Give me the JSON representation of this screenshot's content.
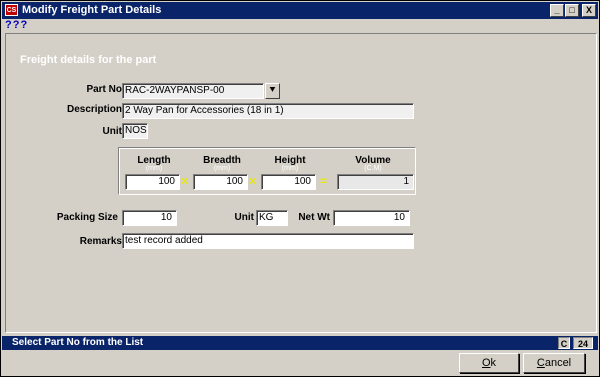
{
  "window": {
    "app_icon_text": "CS",
    "title": "Modify Freight Part Details",
    "btn_min": "_",
    "btn_max": "□",
    "btn_close": "X"
  },
  "menu": {
    "help": "???"
  },
  "form": {
    "section_title": "Freight details for the part",
    "part_no_label": "Part No",
    "part_no_value": "RAC-2WAYPANSP-00",
    "part_no_dropdown_glyph": "⯆",
    "description_label": "Description",
    "description_value": "2 Way Pan for Accessories (18 in 1)",
    "unit_label": "Unit",
    "unit_value": "NOS",
    "dimensions": {
      "length_label": "Length",
      "length_unit": "(mm)",
      "length_value": "100",
      "breadth_label": "Breadth",
      "breadth_unit": "(mm)",
      "breadth_value": "100",
      "height_label": "Height",
      "height_unit": "(mm)",
      "height_value": "100",
      "volume_label": "Volume",
      "volume_unit": "(C.M)",
      "volume_value": "1",
      "times_symbol": "×",
      "equals_symbol": "="
    },
    "packing_size_label": "Packing Size",
    "packing_size_value": "10",
    "weight_unit_label": "Unit",
    "weight_unit_value": "KG",
    "net_wt_label": "Net Wt",
    "net_wt_value": "10",
    "remarks_label": "Remarks",
    "remarks_value": "test record added"
  },
  "status": {
    "message": "Select Part No from the List",
    "cell_mode": "C",
    "cell_count": "24"
  },
  "buttons": {
    "ok_prefix": "O",
    "ok_rest": "k",
    "cancel_prefix": "C",
    "cancel_rest": "ancel"
  }
}
